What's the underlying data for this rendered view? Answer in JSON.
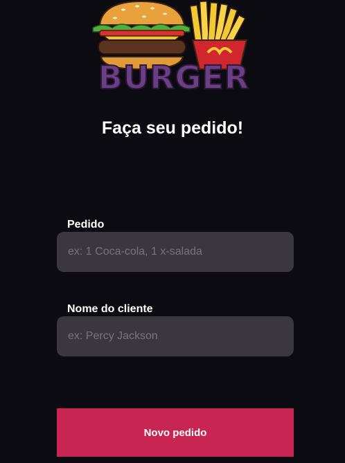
{
  "logo": {
    "text": "BURGER",
    "colors": {
      "text": "#6b3f86",
      "bun": "#e9a13b",
      "fries": "#f3c935",
      "box": "#d0262d"
    }
  },
  "title": "Faça seu pedido!",
  "form": {
    "order": {
      "label": "Pedido",
      "placeholder": "ex: 1 Coca-cola, 1 x-salada",
      "value": ""
    },
    "customer": {
      "label": "Nome do cliente",
      "placeholder": "ex: Percy Jackson",
      "value": ""
    },
    "submit_label": "Novo pedido"
  },
  "colors": {
    "background": "#0d0b12",
    "input": "#3a383e",
    "accent": "#c92552"
  }
}
